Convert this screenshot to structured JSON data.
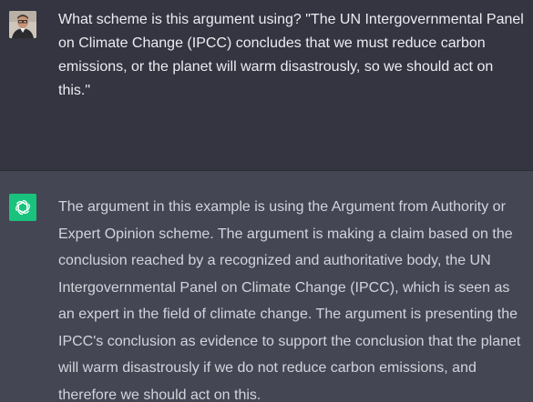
{
  "conversation": {
    "user_message": {
      "avatar_icon": "user-photo-avatar",
      "text": "What scheme is this argument using? \"The UN Intergovernmental Panel on Climate Change (IPCC) concludes that we must reduce carbon emissions, or the planet will warm disastrously, so we should act on this.\""
    },
    "assistant_message": {
      "avatar_icon": "openai-logo-icon",
      "avatar_color": "#19c37d",
      "text": "The argument in this example is using the Argument from Authority or Expert Opinion scheme. The argument is making a claim based on the conclusion reached by a recognized and authoritative body, the UN Intergovernmental Panel on Climate Change (IPCC), which is seen as an expert in the field of climate change. The argument is presenting the IPCC's conclusion as evidence to support the conclusion that the planet will warm disastrously if we do not reduce carbon emissions, and therefore we should act on this."
    }
  },
  "colors": {
    "user_bg": "#343541",
    "assistant_bg": "#444654",
    "user_text": "#ececf1",
    "assistant_text": "#d1d5db"
  }
}
